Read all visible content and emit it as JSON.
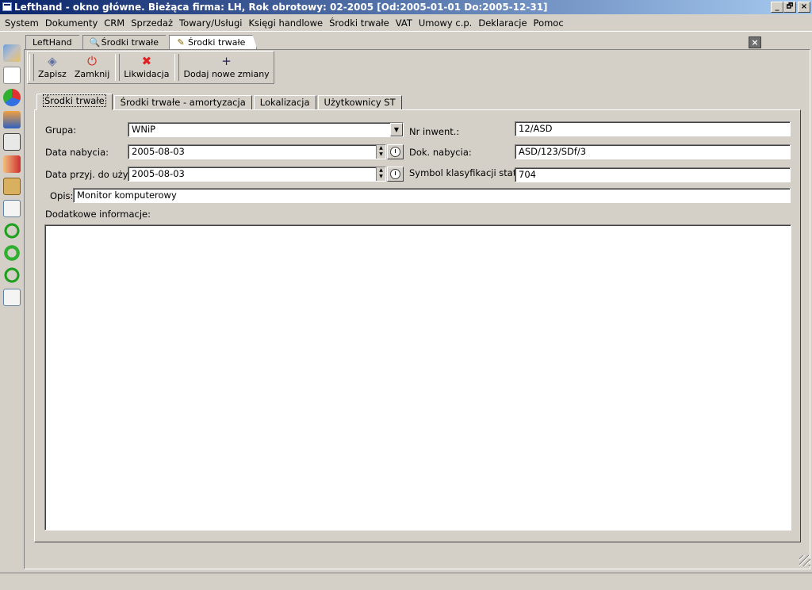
{
  "window": {
    "title": "Lefthand - okno główne. Bieżąca firma: LH, Rok obrotowy: 02-2005 [Od:2005-01-01 Do:2005-12-31]",
    "minimize": "_",
    "restore": "🗗",
    "close": "×"
  },
  "menu": [
    "System",
    "Dokumenty",
    "CRM",
    "Sprzedaż",
    "Towary/Usługi",
    "Księgi handlowe",
    "Środki trwałe",
    "VAT",
    "Umowy c.p.",
    "Deklaracje",
    "Pomoc"
  ],
  "doc_tabs": [
    {
      "label": "LeftHand",
      "icon": ""
    },
    {
      "label": "Środki trwałe",
      "icon": "magnifier-icon"
    },
    {
      "label": "Środki trwałe",
      "icon": "edit-document-icon"
    }
  ],
  "doc_close": "×",
  "toolbar": {
    "save_label": "Zapisz",
    "close_label": "Zamknij",
    "liquidate_label": "Likwidacja",
    "add_changes_label": "Dodaj nowe zmiany"
  },
  "content_tabs": [
    "Środki trwałe",
    "Środki trwałe - amortyzacja",
    "Lokalizacja",
    "Użytkownicy ST"
  ],
  "form": {
    "group_label": "Grupa:",
    "group_value": "WNiP",
    "acquired_label": "Data nabycia:",
    "acquired_value": "2005-08-03",
    "in_use_label": "Data przyj. do użytk.:",
    "in_use_value": "2005-08-03",
    "inv_label": "Nr inwent.:",
    "inv_value": "12/ASD",
    "doc_label": "Dok. nabycia:",
    "doc_value": "ASD/123/SDf/3",
    "symbol_label": "Symbol klasyfikacji statyst.:",
    "symbol_value": "704",
    "desc_label": "Opis:",
    "desc_value": "Monitor komputerowy",
    "extra_label": "Dodatkowe informacje:",
    "extra_value": ""
  },
  "colors": {
    "title_start": "#0a246a",
    "title_end": "#a6caf0",
    "face": "#d4d0c8"
  }
}
